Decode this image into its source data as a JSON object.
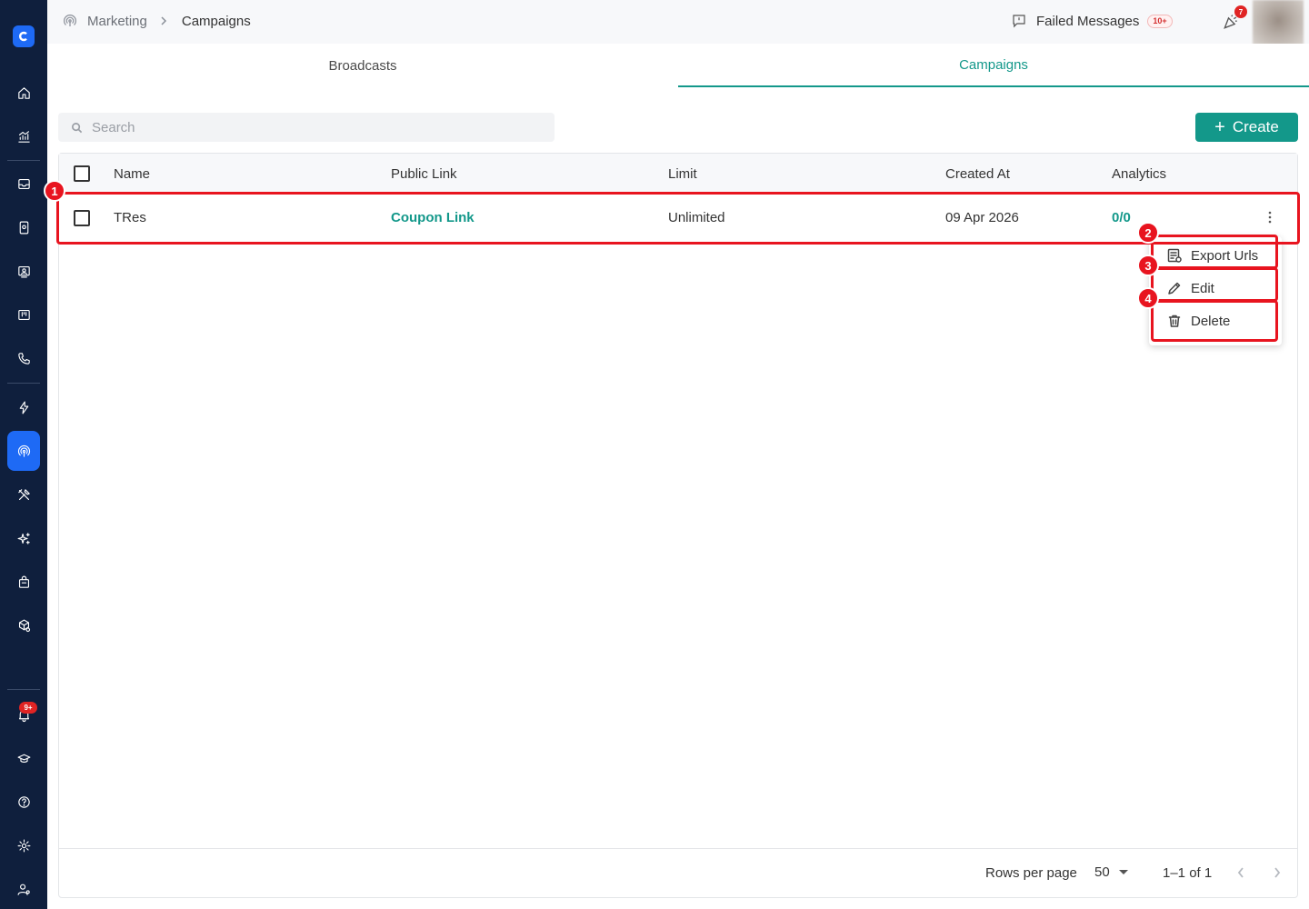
{
  "topbar": {
    "breadcrumb": [
      "Marketing",
      "Campaigns"
    ],
    "failed_messages_label": "Failed Messages",
    "failed_messages_count": "10+",
    "notification_count": "7"
  },
  "sidebar": {
    "notification_badge": "9+",
    "items": [
      "home-icon",
      "analytics-icon",
      "inbox-icon",
      "contacts-icon",
      "team-icon",
      "board-icon",
      "phone-icon",
      "automation-icon",
      "marketing-icon",
      "tools-icon",
      "ai-icon",
      "commerce-icon",
      "settings-box-icon",
      "bell-icon",
      "learn-icon",
      "help-icon",
      "gear-icon",
      "users-icon"
    ]
  },
  "tabs": [
    {
      "label": "Broadcasts",
      "active": false
    },
    {
      "label": "Campaigns",
      "active": true
    }
  ],
  "search": {
    "placeholder": "Search"
  },
  "create_button": {
    "label": "Create"
  },
  "table": {
    "columns": [
      "Name",
      "Public Link",
      "Limit",
      "Created At",
      "Analytics"
    ],
    "rows": [
      {
        "name": "TRes",
        "public_link": "Coupon Link",
        "limit": "Unlimited",
        "created_at": "09 Apr 2026",
        "analytics": "0/0"
      }
    ]
  },
  "pagination": {
    "rows_per_page_label": "Rows per page",
    "rows_per_page": "50",
    "range": "1–1 of 1"
  },
  "row_menu": {
    "items": [
      "Export Urls",
      "Edit",
      "Delete"
    ]
  },
  "annotations": [
    "1",
    "2",
    "3",
    "4"
  ],
  "colors": {
    "accent": "#13988a",
    "sidebar": "#0f1f3d",
    "sidebar_active": "#1e6af5",
    "annotation": "#e8141f"
  }
}
